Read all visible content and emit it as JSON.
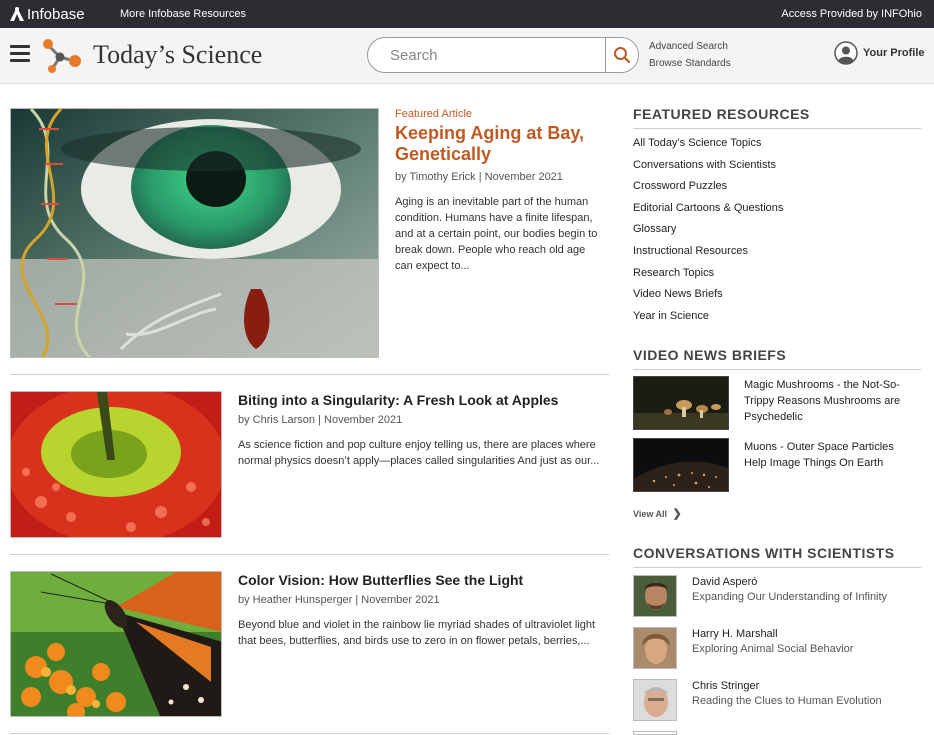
{
  "topbar": {
    "logo": "Infobase",
    "more_resources": "More Infobase Resources",
    "access": "Access Provided by INFOhio"
  },
  "header": {
    "title": "Today’s Science",
    "search_placeholder": "Search",
    "advanced_search": "Advanced Search",
    "browse_standards": "Browse Standards",
    "profile": "Your Profile"
  },
  "featured": {
    "label": "Featured Article",
    "title": "Keeping Aging at Bay, Genetically",
    "byline": "by Timothy Erick | November 2021",
    "excerpt": "Aging is an inevitable part of the human condition. Humans have a finite lifespan, and at a certain point, our bodies begin to break down. People who reach old age can expect to..."
  },
  "articles": [
    {
      "title": "Biting into a Singularity: A Fresh Look at Apples",
      "byline": "by Chris Larson | November 2021",
      "excerpt": "As science fiction and pop culture enjoy telling us, there are places where normal physics doesn’t apply—places called singularities And just as our..."
    },
    {
      "title": "Color Vision: How Butterflies See the Light",
      "byline": "by Heather Hunsperger | November 2021",
      "excerpt": "Beyond blue and violet in the rainbow lie myriad shades of ultraviolet light that bees, butterflies, and birds use to zero in on flower petals, berries,..."
    }
  ],
  "sidebar": {
    "featured_resources": {
      "heading": "FEATURED RESOURCES",
      "items": [
        "All Today’s Science Topics",
        "Conversations with Scientists",
        "Crossword Puzzles",
        "Editorial Cartoons & Questions",
        "Glossary",
        "Instructional Resources",
        "Research Topics",
        "Video News Briefs",
        "Year in Science"
      ]
    },
    "video_news": {
      "heading": "VIDEO NEWS BRIEFS",
      "items": [
        "Magic Mushrooms - the Not-So-Trippy Reasons Mushrooms are Psychedelic",
        "Muons - Outer Space Particles Help Image Things On Earth"
      ],
      "view_all": "View All"
    },
    "conversations": {
      "heading": "CONVERSATIONS WITH SCIENTISTS",
      "items": [
        {
          "name": "David Asperó",
          "topic": "Expanding Our Understanding of Infinity"
        },
        {
          "name": "Harry H. Marshall",
          "topic": "Exploring Animal Social Behavior"
        },
        {
          "name": "Chris Stringer",
          "topic": "Reading the Clues to Human Evolution"
        }
      ]
    }
  },
  "colors": {
    "accent": "#c05a22",
    "topbar": "#2b2d33",
    "header_bg": "#f4f4f4"
  }
}
